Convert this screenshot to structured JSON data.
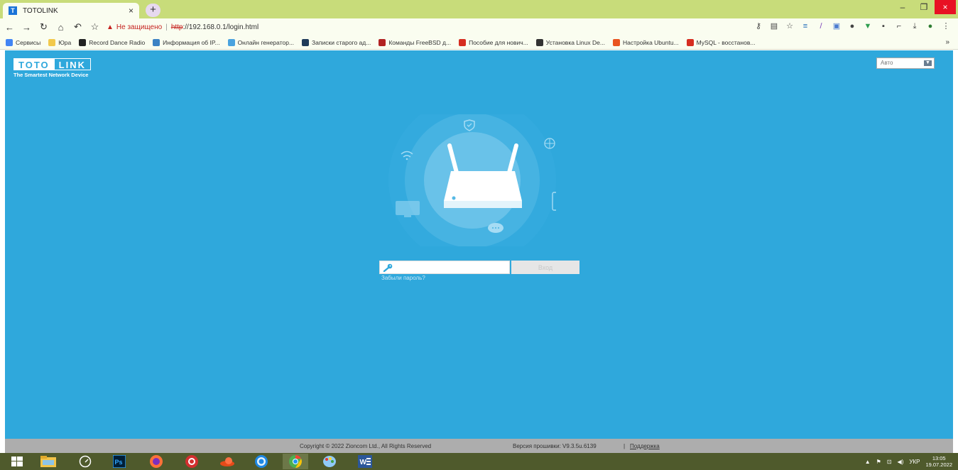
{
  "browser": {
    "tab_title": "TOTOLINK",
    "tab_favicon": "T",
    "tab_close": "×",
    "new_tab": "+",
    "window_min": "–",
    "window_max": "❐",
    "window_close": "×",
    "address": {
      "warning": "Не защищено",
      "scheme": "http",
      "rest": "://192.168.0.1/login.html"
    },
    "bookmarks": [
      {
        "label": "Сервисы",
        "color": "#4285f4"
      },
      {
        "label": "Юра",
        "color": "#f2c94c"
      },
      {
        "label": "Record Dance Radio",
        "color": "#222222"
      },
      {
        "label": "Информация об IP...",
        "color": "#3b82c4"
      },
      {
        "label": "Онлайн генератор...",
        "color": "#4aa3df"
      },
      {
        "label": "Записки старого ад...",
        "color": "#1f3b5a"
      },
      {
        "label": "Команды FreeBSD д...",
        "color": "#b22222"
      },
      {
        "label": "Пособие для нович...",
        "color": "#d62d20"
      },
      {
        "label": "Установка Linux De...",
        "color": "#333333"
      },
      {
        "label": "Настройка Ubuntu...",
        "color": "#e95420"
      },
      {
        "label": "MySQL - восстанов...",
        "color": "#d62d20"
      }
    ],
    "bookmarks_more": "»"
  },
  "router": {
    "logo_left": "TOTO",
    "logo_right": "LINK",
    "tagline": "The Smartest Network Device",
    "language": "Авто",
    "password_placeholder": "",
    "login_label": "Вход",
    "forgot_label": "Забыли пароль?",
    "colors": {
      "background": "#2fa8dc"
    }
  },
  "footer": {
    "copyright": "Copyright © 2022 Zioncom Ltd., All Rights Reserved",
    "firmware": "Версия прошивки: V9.3.5u.6139",
    "separator": "|",
    "support": "Поддержка"
  },
  "taskbar": {
    "language": "УКР",
    "time": "13:05",
    "date": "19.07.2022"
  }
}
